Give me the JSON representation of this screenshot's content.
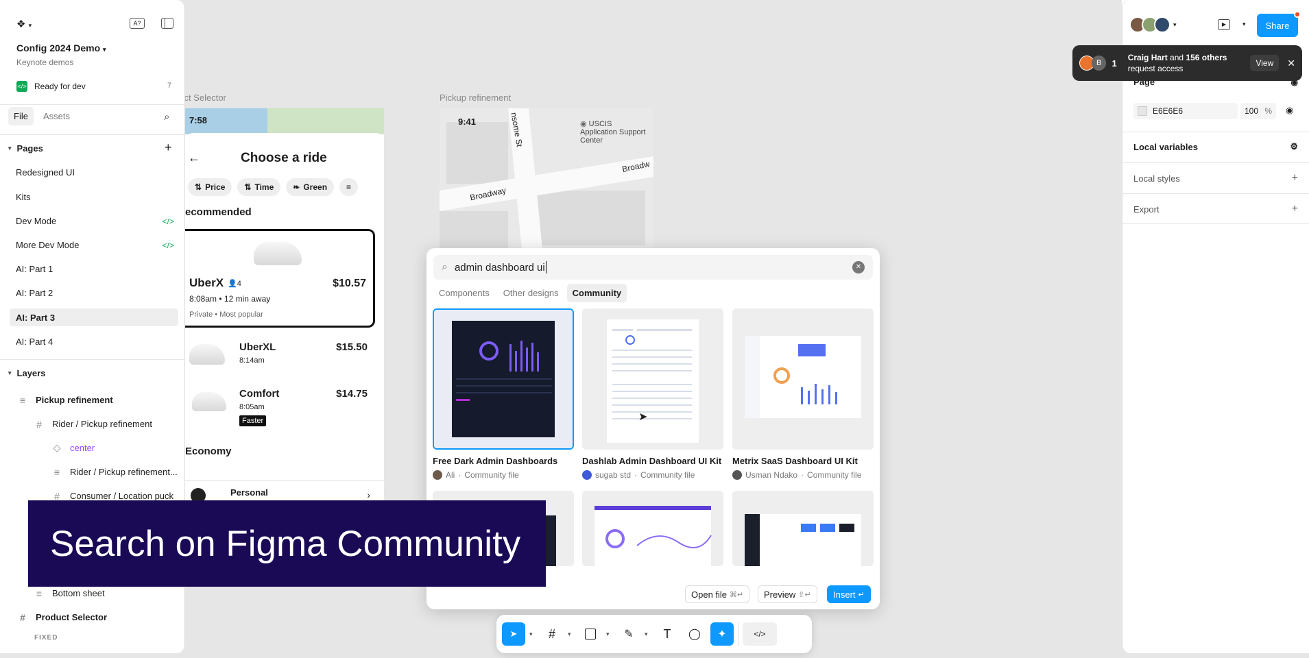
{
  "file": {
    "name": "Config 2024 Demo",
    "subtitle": "Keynote demos",
    "ready_for_dev": "Ready for dev",
    "ready_count": "7"
  },
  "left_tabs": {
    "file": "File",
    "assets": "Assets"
  },
  "pages": {
    "header": "Pages",
    "items": [
      {
        "label": "Redesigned UI"
      },
      {
        "label": "Kits"
      },
      {
        "label": "Dev Mode"
      },
      {
        "label": "More Dev Mode"
      },
      {
        "label": "AI: Part 1"
      },
      {
        "label": "AI: Part 2"
      },
      {
        "label": "AI: Part 3"
      },
      {
        "label": "AI: Part 4"
      }
    ]
  },
  "layers": {
    "header": "Layers",
    "items": [
      {
        "label": "Pickup refinement"
      },
      {
        "label": "Rider / Pickup refinement"
      },
      {
        "label": "center"
      },
      {
        "label": "Rider / Pickup refinement..."
      },
      {
        "label": "Consumer / Location puck"
      },
      {
        "label": "Bottom sheet"
      },
      {
        "label": "Product Selector"
      }
    ],
    "fixed_label": "FIXED"
  },
  "canvas": {
    "frame_left_label": "duct Selector",
    "frame_right_label": "Pickup refinement",
    "left_time": "7:58",
    "right_time": "9:41",
    "choose_ride": "Choose a ride",
    "chips": [
      "Price",
      "Time",
      "Green"
    ],
    "recommended": "ecommended",
    "economy": "Economy",
    "rides": [
      {
        "name": "UberX",
        "seats": "4",
        "time": "8:08am • 12 min away",
        "desc": "Private • Most popular",
        "price": "$10.57"
      },
      {
        "name": "UberXL",
        "time": "8:14am",
        "price": "$15.50"
      },
      {
        "name": "Comfort",
        "time": "8:05am",
        "badge": "Faster",
        "price": "$14.75"
      }
    ],
    "personal": "Personal",
    "map_labels": {
      "street1": "Broadway",
      "street2": "Broadw",
      "street3": "nsome St",
      "poi": "USCIS Application Support Center"
    }
  },
  "right_panel": {
    "page_header": "Page",
    "page_color": "E6E6E6",
    "page_opacity": "100",
    "opacity_unit": "%",
    "local_variables": "Local variables",
    "local_styles": "Local styles",
    "export": "Export",
    "share": "Share"
  },
  "toast": {
    "avatar_letter": "B",
    "count": "1",
    "name": "Craig Hart",
    "mid": " and ",
    "others": "156 others",
    "line2": "request access",
    "view": "View"
  },
  "modal": {
    "query": "admin dashboard ui",
    "tabs": [
      "Components",
      "Other designs",
      "Community"
    ],
    "results": [
      {
        "title": "Free Dark Admin Dashboards",
        "author": "Ali",
        "kind": "Community file"
      },
      {
        "title": "Dashlab Admin Dashboard UI Kit",
        "author": "sugab std",
        "kind": "Community file"
      },
      {
        "title": "Metrix SaaS Dashboard UI Kit",
        "author": "Usman Ndako",
        "kind": "Community file"
      }
    ],
    "sep": " · ",
    "open_file": "Open file",
    "open_file_kbd": "⌘↵",
    "preview": "Preview",
    "preview_kbd": "⇧↵",
    "insert": "Insert",
    "insert_kbd": "↵"
  },
  "banner": "Search on Figma Community",
  "colors": {
    "accent": "#0d99ff",
    "banner_bg": "#1a0a56",
    "dev_green": "#0fa958",
    "layer_purple": "#9747ff"
  }
}
